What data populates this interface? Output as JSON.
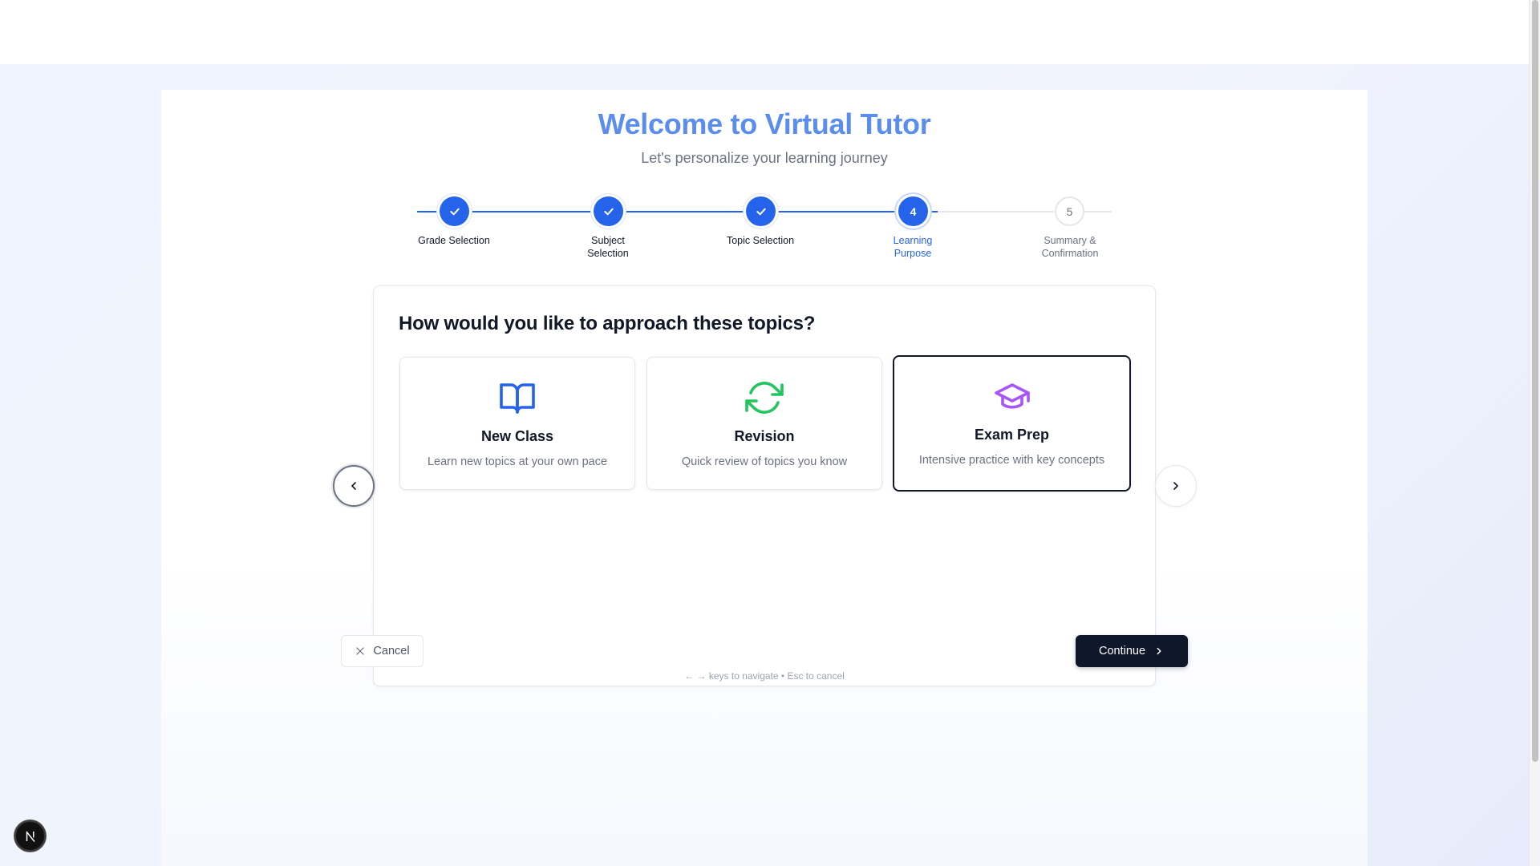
{
  "header": {
    "title": "Welcome to Virtual Tutor",
    "subtitle": "Let's personalize your learning journey"
  },
  "stepper": {
    "steps": [
      {
        "number": "1",
        "label_line1": "Grade Selection",
        "label_line2": "",
        "state": "done"
      },
      {
        "number": "2",
        "label_line1": "Subject",
        "label_line2": "Selection",
        "state": "done"
      },
      {
        "number": "3",
        "label_line1": "Topic Selection",
        "label_line2": "",
        "state": "done"
      },
      {
        "number": "4",
        "label_line1": "Learning",
        "label_line2": "Purpose",
        "state": "active"
      },
      {
        "number": "5",
        "label_line1": "Summary &",
        "label_line2": "Confirmation",
        "state": "todo"
      }
    ],
    "done_icon": "check-icon"
  },
  "question": {
    "text": "How would you like to approach these topics?",
    "options": [
      {
        "title": "New Class",
        "description": "Learn new topics at your own pace",
        "icon": "open-book-icon",
        "icon_color": "#2563eb",
        "selected": false
      },
      {
        "title": "Revision",
        "description": "Quick review of topics you know",
        "icon": "refresh-icon",
        "icon_color": "#22c55e",
        "selected": false
      },
      {
        "title": "Exam Prep",
        "description": "Intensive practice with key concepts",
        "icon": "graduation-cap-icon",
        "icon_color": "#a855f7",
        "selected": true
      }
    ]
  },
  "actions": {
    "cancel_label": "Cancel",
    "continue_label": "Continue",
    "hint": "← → keys to navigate • Esc to cancel"
  },
  "colors": {
    "accent": "#2563eb",
    "title": "#5b8def",
    "primary_button": "#0f172a"
  },
  "devtools": {
    "badge_letter": "N"
  }
}
